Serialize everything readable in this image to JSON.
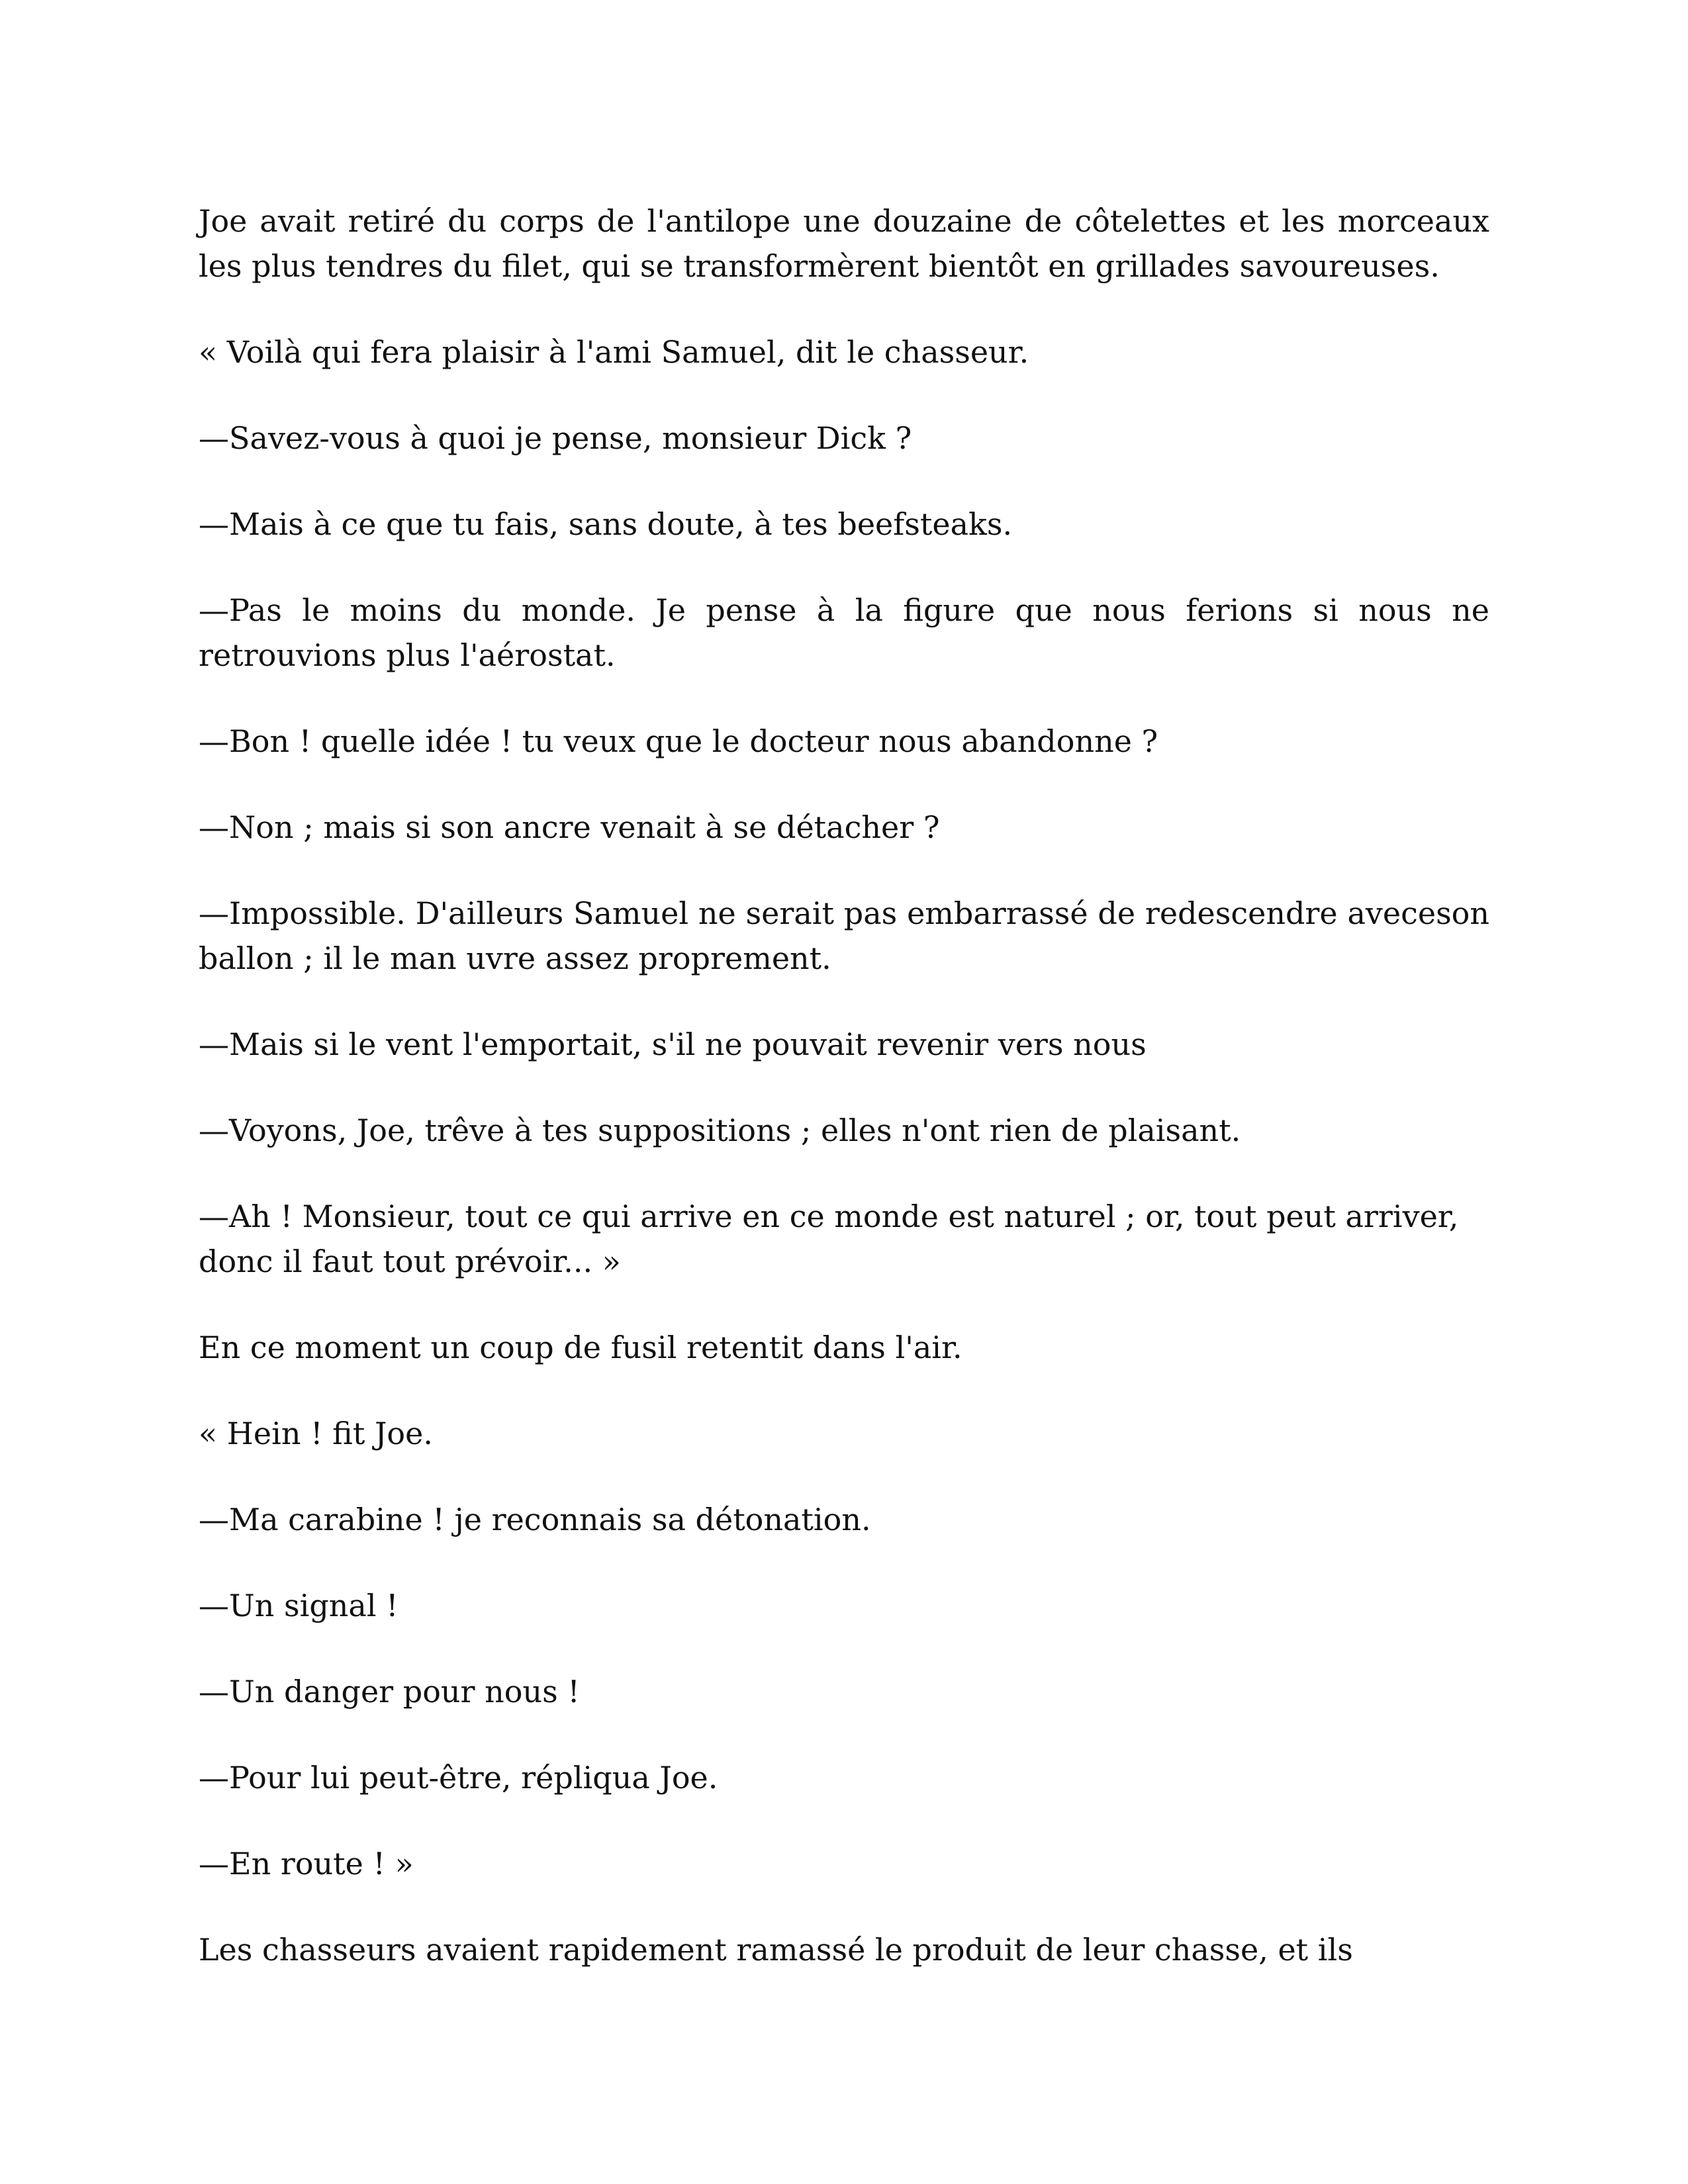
{
  "document": {
    "paragraphs": [
      {
        "text": "Joe avait retiré du corps de l'antilope une douzaine de côtelettes et les morceaux les plus tendres du filet, qui se transformèrent bientôt en grillades savoureuses.",
        "justify": true
      },
      {
        "text": "« Voilà qui fera plaisir à l'ami Samuel, dit le chasseur.",
        "justify": false
      },
      {
        "text": "—Savez-vous à quoi je pense, monsieur Dick ?",
        "justify": false
      },
      {
        "text": "—Mais à ce que tu fais, sans doute, à tes beefsteaks.",
        "justify": false
      },
      {
        "text": "—Pas le moins du monde. Je pense à la figure que nous ferions si nous ne retrouvions plus l'aérostat.",
        "justify": true
      },
      {
        "text": "—Bon ! quelle idée ! tu veux que le docteur nous abandonne ?",
        "justify": false
      },
      {
        "text": "—Non ; mais si son ancre venait à se détacher ?",
        "justify": false
      },
      {
        "text": "—Impossible. D'ailleurs Samuel ne serait pas embarrassé de redescendre aveceson ballon ; il le man uvre assez proprement.",
        "justify": true
      },
      {
        "text": "—Mais si le vent l'emportait, s'il ne pouvait revenir vers nous",
        "justify": false
      },
      {
        "text": "—Voyons, Joe, trêve à tes suppositions ; elles n'ont rien de plaisant.",
        "justify": false
      },
      {
        "text": "—Ah ! Monsieur, tout ce qui arrive en ce monde est naturel ; or, tout peut arriver, donc il faut tout prévoir... »",
        "justify": false
      },
      {
        "text": "En ce moment un coup de fusil retentit dans l'air.",
        "justify": false
      },
      {
        "text": "« Hein ! fit Joe.",
        "justify": false
      },
      {
        "text": "—Ma carabine ! je reconnais sa détonation.",
        "justify": false
      },
      {
        "text": "—Un signal !",
        "justify": false
      },
      {
        "text": "—Un danger pour nous !",
        "justify": false
      },
      {
        "text": "—Pour lui peut-être, répliqua Joe.",
        "justify": false
      },
      {
        "text": "—En route ! »",
        "justify": false
      },
      {
        "text": "Les chasseurs avaient rapidement ramassé le produit de leur chasse, et ils",
        "justify": false
      }
    ]
  }
}
